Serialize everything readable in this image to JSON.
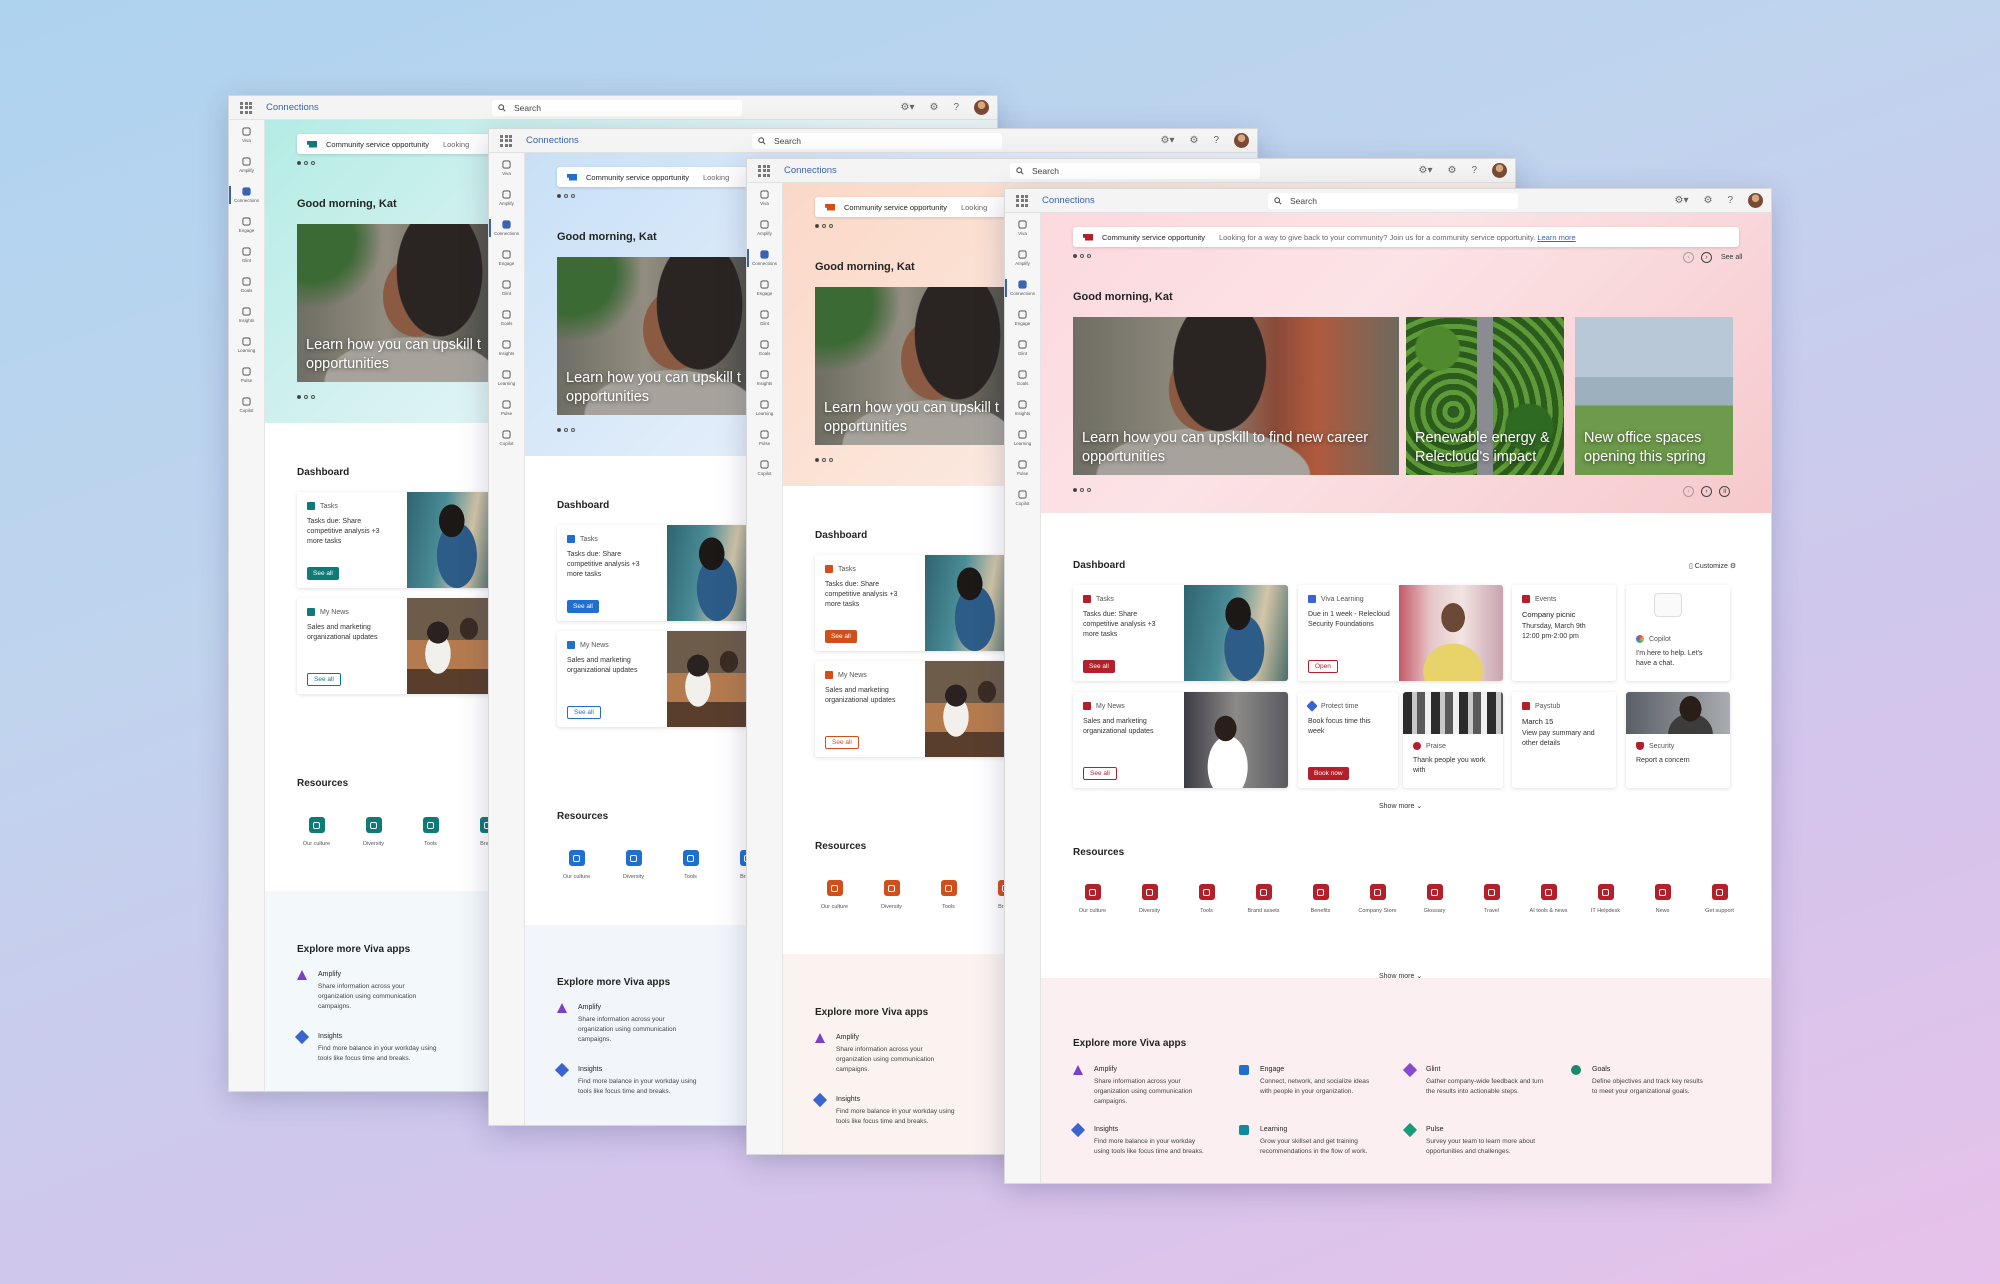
{
  "app": {
    "title": "Connections",
    "search_placeholder": "Search",
    "greeting": "Good morning, Kat"
  },
  "rail": [
    "Viva",
    "Amplify",
    "Connections",
    "Engage",
    "Glint",
    "Goals",
    "Insights",
    "Learning",
    "Pulse",
    "Copilot"
  ],
  "banner": {
    "title": "Community service opportunity",
    "text_short": "Looking",
    "text": "Looking for a way to give back to your community? Join us for a community service opportunity.",
    "link": "Learn more"
  },
  "hero": {
    "caption_1": "Learn how you can upskill t",
    "caption_2": "opportunities",
    "full_1": "Learn how you can upskill to find new career",
    "full_2": "opportunities",
    "card2_1": "Renewable energy &",
    "card2_2": "Relecloud's impact",
    "card3_1": "New office spaces",
    "card3_2": "opening this spring",
    "see_all": "See all"
  },
  "dashboard": {
    "title": "Dashboard",
    "customize": "Customize",
    "tasks": {
      "header": "Tasks",
      "text": "Tasks due: Share competitive analysis +3 more tasks",
      "button": "See all"
    },
    "news": {
      "header": "My News",
      "text": "Sales and marketing organizational updates",
      "button": "See all"
    },
    "learning": {
      "header": "Viva Learning",
      "text": "Due in 1 week - Relecloud Security Foundations",
      "button": "Open"
    },
    "events": {
      "header": "Events",
      "title": "Company picnic",
      "text": "Thursday, March 9th 12:00 pm-2:00 pm"
    },
    "copilot": {
      "header": "Copilot",
      "text": "I'm here to help. Let's have a chat."
    },
    "protect": {
      "header": "Protect time",
      "text": "Book focus time this week",
      "button": "Book now"
    },
    "praise": {
      "header": "Praise",
      "text": "Thank people you work with"
    },
    "paystub": {
      "header": "Paystub",
      "title": "March 15",
      "text": "View pay summary and other details"
    },
    "security": {
      "header": "Security",
      "text": "Report a concern"
    },
    "show_more": "Show more ⌄"
  },
  "resources": {
    "title": "Resources",
    "items": [
      "Our culture",
      "Diversity",
      "Tools",
      "Brand assets",
      "Benefits",
      "Company Store",
      "Glossary",
      "Travel",
      "AI tools & news",
      "IT Helpdesk",
      "News",
      "Get support"
    ],
    "item_short": "Brand",
    "show_more": "Show more ⌄"
  },
  "explore": {
    "title": "Explore more Viva apps",
    "amplify": {
      "name": "Amplify",
      "text": "Share information across your organization using communication campaigns."
    },
    "insights": {
      "name": "Insights",
      "text": "Find more balance in your workday using tools like focus time and breaks."
    },
    "engage": {
      "name": "Engage",
      "text": "Connect, network, and socialize ideas with people in your organization."
    },
    "learning": {
      "name": "Learning",
      "text": "Grow your skillset and get training recommendations in the flow of work."
    },
    "glint": {
      "name": "Glint",
      "text": "Gather company-wide feedback and turn the results into actionable steps."
    },
    "pulse": {
      "name": "Pulse",
      "text": "Survey your team to learn more about opportunities and challenges."
    },
    "goals": {
      "name": "Goals",
      "text": "Define objectives and track key results to meet your organizational goals."
    }
  },
  "colors": {
    "teal": "#0f7b78",
    "blue": "#1f6fd1",
    "orange": "#d24f1c",
    "red": "#b3202a",
    "brand": "#3a64b0"
  }
}
